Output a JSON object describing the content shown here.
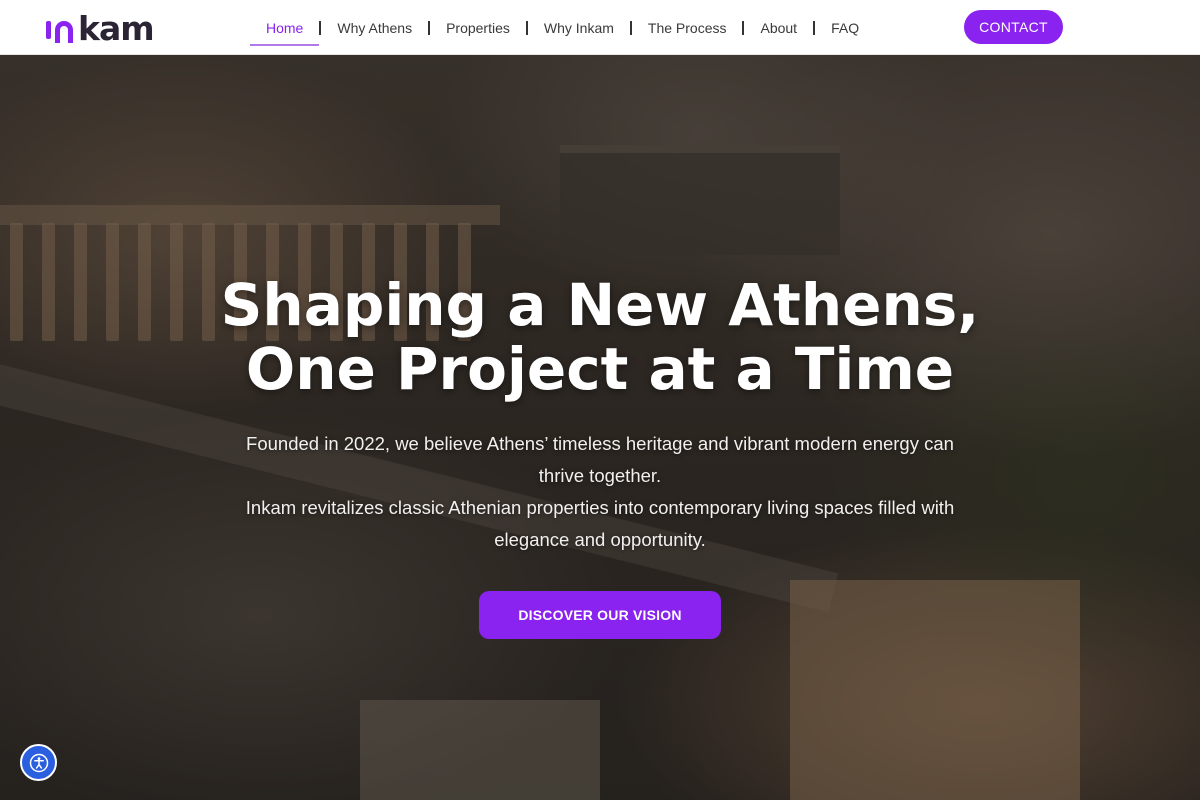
{
  "brand": {
    "logo_text": "kam",
    "accent": "#8a22f0"
  },
  "nav": {
    "items": [
      {
        "label": "Home",
        "active": true
      },
      {
        "label": "Why Athens"
      },
      {
        "label": "Properties"
      },
      {
        "label": "Why Inkam"
      },
      {
        "label": "The Process"
      },
      {
        "label": "About"
      },
      {
        "label": "FAQ"
      }
    ],
    "contact_label": "CONTACT"
  },
  "hero": {
    "title_line1": "Shaping a New Athens,",
    "title_line2": "One Project at a Time",
    "sub_line1": "Founded in 2022, we believe Athens’ timeless heritage and vibrant modern energy can thrive together.",
    "sub_line2": "Inkam revitalizes classic Athenian properties into contemporary living spaces filled with elegance and opportunity.",
    "cta_label": "DISCOVER OUR VISION",
    "background_icon": "acropolis-aerial-photo"
  },
  "accessibility": {
    "icon": "accessibility-icon"
  }
}
